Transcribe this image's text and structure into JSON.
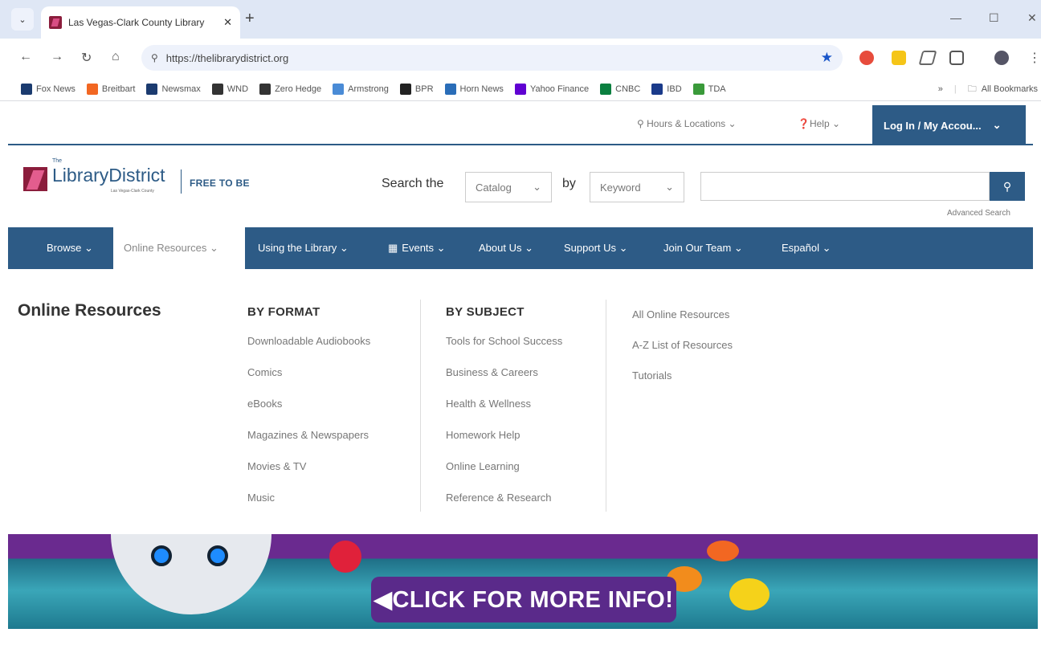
{
  "browser": {
    "tab_title": "Las Vegas-Clark County Library",
    "url": "https://thelibrarydistrict.org",
    "bookmarks": [
      {
        "label": "Fox News",
        "color": "#1b3b6f"
      },
      {
        "label": "Breitbart",
        "color": "#f26722"
      },
      {
        "label": "Newsmax",
        "color": "#1b3b6f"
      },
      {
        "label": "WND",
        "color": "#333333"
      },
      {
        "label": "Zero Hedge",
        "color": "#333333"
      },
      {
        "label": "Armstrong",
        "color": "#4a8bd6"
      },
      {
        "label": "BPR",
        "color": "#222222"
      },
      {
        "label": "Horn News",
        "color": "#2a6db8"
      },
      {
        "label": "Yahoo Finance",
        "color": "#6001d2"
      },
      {
        "label": "CNBC",
        "color": "#0a7f3f"
      },
      {
        "label": "IBD",
        "color": "#1a3a8a"
      },
      {
        "label": "TDA",
        "color": "#3a9a3a"
      }
    ],
    "more_bookmarks": "»",
    "all_bookmarks": "All Bookmarks"
  },
  "utility": {
    "hours": "Hours & Locations",
    "help": "Help",
    "login": "Log In / My Accou..."
  },
  "header": {
    "logo_small": "The",
    "logo_name": "LibraryDistrict",
    "logo_sub": "Las Vegas-Clark County",
    "tagline": "FREE TO BE",
    "search_the": "Search the",
    "by": "by",
    "catalog": "Catalog",
    "keyword": "Keyword",
    "advanced_search": "Advanced Search"
  },
  "nav": [
    {
      "label": "Browse ⌄"
    },
    {
      "label": "Online Resources ⌄"
    },
    {
      "label": "Using the Library ⌄"
    },
    {
      "label": "Events ⌄"
    },
    {
      "label": "About Us ⌄"
    },
    {
      "label": "Support Us ⌄"
    },
    {
      "label": "Join Our Team ⌄"
    },
    {
      "label": "Español ⌄"
    }
  ],
  "mega": {
    "title": "Online Resources",
    "by_format": {
      "heading": "BY FORMAT",
      "links": [
        "Downloadable Audiobooks",
        "Comics",
        "eBooks",
        "Magazines & Newspapers",
        "Movies & TV",
        "Music"
      ]
    },
    "by_subject": {
      "heading": "BY SUBJECT",
      "links": [
        "Tools for School Success",
        "Business & Careers",
        "Health & Wellness",
        "Homework Help",
        "Online Learning",
        "Reference & Research"
      ]
    },
    "other": {
      "links": [
        "All Online Resources",
        "A-Z List of Resources",
        "Tutorials"
      ]
    }
  },
  "banner": {
    "cta": "◀CLICK FOR MORE INFO!"
  },
  "colors": {
    "brand_blue": "#2d5b86",
    "brand_maroon": "#8b1d3c",
    "banner_purple": "#5a2a8a"
  }
}
